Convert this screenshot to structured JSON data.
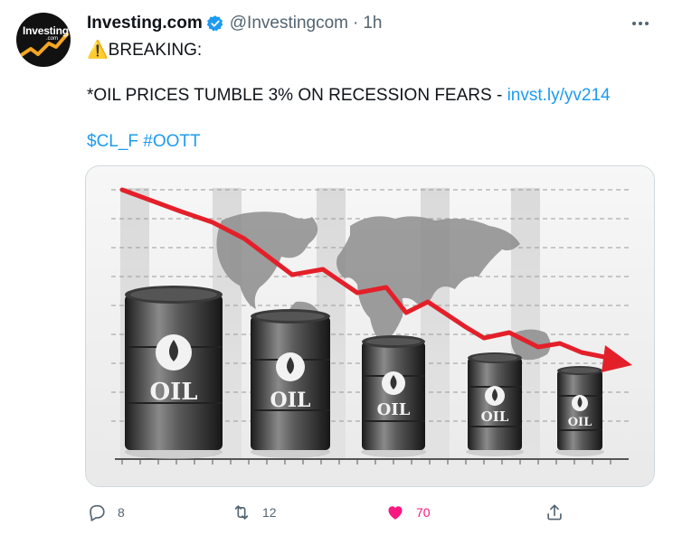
{
  "author": {
    "name": "Investing.com",
    "handle": "@Investingcom",
    "separator": "·",
    "time": "1h",
    "avatar_text": "Investing",
    "avatar_subtext": ".com"
  },
  "tweet": {
    "breaking_emoji": "⚠️",
    "breaking_label": "BREAKING:",
    "headline": "*OIL PRICES TUMBLE 3% ON RECESSION FEARS - ",
    "link": "invst.ly/yv214",
    "tags": "$CL_F #OOTT"
  },
  "media": {
    "barrel_label": "OIL"
  },
  "actions": {
    "replies": "8",
    "retweets": "12",
    "likes": "70"
  },
  "colors": {
    "link": "#1d9bf0",
    "like": "#f91880",
    "muted": "#536471",
    "trend_arrow": "#e3202a"
  },
  "icons": {
    "more": "more-icon",
    "verified": "verified-badge-icon",
    "reply": "reply-icon",
    "retweet": "retweet-icon",
    "like": "heart-icon",
    "share": "share-icon"
  }
}
